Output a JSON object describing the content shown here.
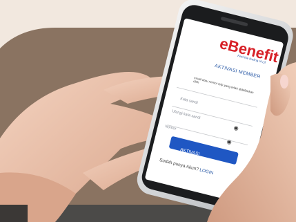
{
  "app": {
    "logo_text": "eBenefit",
    "tagline": "Feel the feeling of Lif",
    "brand_color": "#d72027",
    "accent_color": "#1f57c3"
  },
  "form": {
    "title": "AKTIVASI MEMBER",
    "hint": "email atau nomor telp yang telah didaftarkan oleh",
    "fields": [
      {
        "placeholder": "Kata sandi",
        "icon": "none"
      },
      {
        "placeholder": "Ulangi kata sandi",
        "icon": "eye-icon"
      },
      {
        "placeholder": "Nomor",
        "icon": "eye-icon"
      }
    ],
    "activate_button": "AKTIVASI",
    "footer_text": "Sudah punya Akun?",
    "login_link": "LOGIN"
  }
}
